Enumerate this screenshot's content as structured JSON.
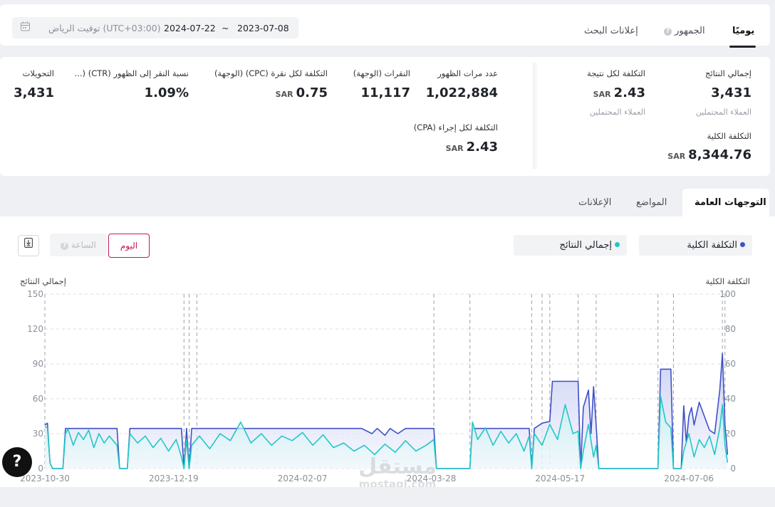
{
  "topbar": {
    "tabs": [
      {
        "label": "يوميًا",
        "active": true
      },
      {
        "label": "الجمهور",
        "active": false
      },
      {
        "label": "إعلانات البحث",
        "active": false
      }
    ],
    "timezone": "(UTC+03:00) توقيت الرياض",
    "date_from": "2023-07-08",
    "date_to": "2024-07-22",
    "date_separator": "~",
    "calendar_icon": "calendar-icon"
  },
  "metrics": {
    "total_results": {
      "label": "إجمالي النتائج",
      "value": "3,431",
      "sub": "العملاء المحتملين"
    },
    "cost_per_result": {
      "label": "التكلفة لكل نتيجة",
      "value": "2.43",
      "currency": "SAR",
      "sub": "العملاء المحتملين"
    },
    "total_cost": {
      "label": "التكلفة الكلية",
      "value": "8,344.76",
      "currency": "SAR"
    },
    "impressions": {
      "label": "عدد مرات الظهور",
      "value": "1,022,884"
    },
    "clicks": {
      "label": "النقرات (الوجهة)",
      "value": "11,117"
    },
    "cpc": {
      "label": "التكلفة لكل نقرة (CPC) (الوجهة)",
      "value": "0.75",
      "currency": "SAR"
    },
    "ctr": {
      "label": "نسبة النقر إلى الظهور (CTR) (...",
      "value": "1.09%"
    },
    "conversions": {
      "label": "التحويلات",
      "value": "3,431"
    },
    "cpa": {
      "label": "التكلفة لكل إجراء (CPA)",
      "value": "2.43",
      "currency": "SAR"
    }
  },
  "section_tabs": [
    {
      "label": "التوجهات العامة",
      "active": true
    },
    {
      "label": "المواضع",
      "active": false
    },
    {
      "label": "الإعلانات",
      "active": false
    }
  ],
  "chart_controls": {
    "day_button": "اليوم",
    "hour_button": "الساعة",
    "export_icon": "download-icon",
    "legend_cost": "التكلفة الكلية",
    "legend_results": "إجمالي النتائج"
  },
  "help_icon": "help-icon",
  "watermark": {
    "ar": "مستقل",
    "en": "mostaql.com"
  },
  "chart_data": {
    "type": "line",
    "left_axis_label": "إجمالي النتائج",
    "right_axis_label": "التكلفة الكلية",
    "left_ticks": [
      0,
      30,
      60,
      90,
      120,
      150
    ],
    "right_ticks": [
      0,
      20,
      40,
      60,
      80,
      100
    ],
    "ylim_left": [
      0,
      150
    ],
    "ylim_right": [
      0,
      100
    ],
    "x_tick_labels": [
      "2023-10-30",
      "2023-12-19",
      "2024-02-07",
      "2024-03-28",
      "2024-05-17",
      "2024-07-06"
    ],
    "x_range": [
      "2023-10-30",
      "2024-07-22"
    ],
    "grid": true,
    "colors": {
      "cost": "#3f51c6",
      "results": "#22c7c7",
      "cost_fill": "#d9ddf6",
      "results_fill": "#d7f6f6"
    },
    "series": [
      {
        "name": "التكلفة الكلية",
        "axis": "right",
        "color": "#3f51c6",
        "values": [
          [
            "2023-10-30",
            25
          ],
          [
            "2023-10-31",
            26
          ],
          [
            "2023-11-01",
            3
          ],
          [
            "2023-11-02",
            0
          ],
          [
            "2023-11-06",
            0
          ],
          [
            "2023-11-07",
            23
          ],
          [
            "2023-11-10",
            23
          ],
          [
            "2023-11-20",
            23
          ],
          [
            "2023-11-27",
            23
          ],
          [
            "2023-11-28",
            0
          ],
          [
            "2023-12-01",
            0
          ],
          [
            "2023-12-02",
            23
          ],
          [
            "2023-12-10",
            23
          ],
          [
            "2023-12-22",
            23
          ],
          [
            "2023-12-23",
            0
          ],
          [
            "2023-12-24",
            23
          ],
          [
            "2023-12-25",
            0
          ],
          [
            "2023-12-26",
            23
          ],
          [
            "2024-01-10",
            23
          ],
          [
            "2024-02-01",
            23
          ],
          [
            "2024-02-20",
            23
          ],
          [
            "2024-03-01",
            23
          ],
          [
            "2024-03-05",
            20
          ],
          [
            "2024-03-07",
            23
          ],
          [
            "2024-03-10",
            19
          ],
          [
            "2024-03-12",
            23
          ],
          [
            "2024-03-15",
            20
          ],
          [
            "2024-03-18",
            23
          ],
          [
            "2024-03-29",
            23
          ],
          [
            "2024-03-30",
            0
          ],
          [
            "2024-04-12",
            0
          ],
          [
            "2024-04-13",
            23
          ],
          [
            "2024-04-25",
            23
          ],
          [
            "2024-05-05",
            23
          ],
          [
            "2024-05-06",
            0
          ],
          [
            "2024-05-07",
            23
          ],
          [
            "2024-05-10",
            26
          ],
          [
            "2024-05-13",
            27
          ],
          [
            "2024-05-14",
            50
          ],
          [
            "2024-05-24",
            50
          ],
          [
            "2024-05-25",
            0
          ],
          [
            "2024-05-26",
            35
          ],
          [
            "2024-05-27",
            40
          ],
          [
            "2024-05-28",
            45
          ],
          [
            "2024-05-29",
            20
          ],
          [
            "2024-05-30",
            47
          ],
          [
            "2024-05-31",
            25
          ],
          [
            "2024-06-01",
            0
          ],
          [
            "2024-06-24",
            0
          ],
          [
            "2024-06-25",
            57
          ],
          [
            "2024-06-29",
            57
          ],
          [
            "2024-06-30",
            0
          ],
          [
            "2024-07-03",
            0
          ],
          [
            "2024-07-04",
            36
          ],
          [
            "2024-07-05",
            15
          ],
          [
            "2024-07-06",
            30
          ],
          [
            "2024-07-07",
            35
          ],
          [
            "2024-07-08",
            25
          ],
          [
            "2024-07-10",
            38
          ],
          [
            "2024-07-12",
            30
          ],
          [
            "2024-07-14",
            22
          ],
          [
            "2024-07-16",
            20
          ],
          [
            "2024-07-18",
            45
          ],
          [
            "2024-07-19",
            66
          ],
          [
            "2024-07-20",
            25
          ],
          [
            "2024-07-21",
            8
          ]
        ]
      },
      {
        "name": "إجمالي النتائج",
        "axis": "left",
        "color": "#22c7c7",
        "values": [
          [
            "2023-10-30",
            36
          ],
          [
            "2023-10-31",
            35
          ],
          [
            "2023-11-01",
            5
          ],
          [
            "2023-11-02",
            0
          ],
          [
            "2023-11-06",
            0
          ],
          [
            "2023-11-07",
            30
          ],
          [
            "2023-11-08",
            34
          ],
          [
            "2023-11-10",
            20
          ],
          [
            "2023-11-12",
            31
          ],
          [
            "2023-11-14",
            25
          ],
          [
            "2023-11-16",
            33
          ],
          [
            "2023-11-18",
            18
          ],
          [
            "2023-11-20",
            30
          ],
          [
            "2023-11-22",
            22
          ],
          [
            "2023-11-24",
            28
          ],
          [
            "2023-11-27",
            20
          ],
          [
            "2023-11-28",
            0
          ],
          [
            "2023-12-01",
            0
          ],
          [
            "2023-12-02",
            30
          ],
          [
            "2023-12-05",
            22
          ],
          [
            "2023-12-08",
            28
          ],
          [
            "2023-12-11",
            18
          ],
          [
            "2023-12-14",
            26
          ],
          [
            "2023-12-17",
            15
          ],
          [
            "2023-12-20",
            25
          ],
          [
            "2023-12-22",
            10
          ],
          [
            "2023-12-23",
            0
          ],
          [
            "2023-12-24",
            25
          ],
          [
            "2023-12-25",
            0
          ],
          [
            "2023-12-26",
            20
          ],
          [
            "2023-12-29",
            28
          ],
          [
            "2024-01-02",
            17
          ],
          [
            "2024-01-06",
            30
          ],
          [
            "2024-01-10",
            24
          ],
          [
            "2024-01-14",
            40
          ],
          [
            "2024-01-18",
            22
          ],
          [
            "2024-01-22",
            30
          ],
          [
            "2024-01-26",
            20
          ],
          [
            "2024-01-30",
            28
          ],
          [
            "2024-02-03",
            24
          ],
          [
            "2024-02-07",
            31
          ],
          [
            "2024-02-11",
            20
          ],
          [
            "2024-02-15",
            29
          ],
          [
            "2024-02-19",
            18
          ],
          [
            "2024-02-23",
            22
          ],
          [
            "2024-02-27",
            15
          ],
          [
            "2024-03-02",
            20
          ],
          [
            "2024-03-06",
            12
          ],
          [
            "2024-03-10",
            21
          ],
          [
            "2024-03-14",
            14
          ],
          [
            "2024-03-18",
            24
          ],
          [
            "2024-03-22",
            15
          ],
          [
            "2024-03-26",
            20
          ],
          [
            "2024-03-29",
            25
          ],
          [
            "2024-03-30",
            0
          ],
          [
            "2024-04-12",
            0
          ],
          [
            "2024-04-13",
            40
          ],
          [
            "2024-04-15",
            25
          ],
          [
            "2024-04-18",
            35
          ],
          [
            "2024-04-21",
            20
          ],
          [
            "2024-04-24",
            32
          ],
          [
            "2024-04-27",
            22
          ],
          [
            "2024-04-30",
            30
          ],
          [
            "2024-05-03",
            15
          ],
          [
            "2024-05-05",
            28
          ],
          [
            "2024-05-06",
            0
          ],
          [
            "2024-05-07",
            30
          ],
          [
            "2024-05-10",
            20
          ],
          [
            "2024-05-13",
            38
          ],
          [
            "2024-05-16",
            25
          ],
          [
            "2024-05-19",
            55
          ],
          [
            "2024-05-22",
            30
          ],
          [
            "2024-05-24",
            32
          ],
          [
            "2024-05-25",
            0
          ],
          [
            "2024-05-26",
            15
          ],
          [
            "2024-05-28",
            38
          ],
          [
            "2024-05-30",
            10
          ],
          [
            "2024-05-31",
            20
          ],
          [
            "2024-06-01",
            0
          ],
          [
            "2024-06-24",
            0
          ],
          [
            "2024-06-25",
            62
          ],
          [
            "2024-06-27",
            40
          ],
          [
            "2024-06-29",
            35
          ],
          [
            "2024-06-30",
            0
          ],
          [
            "2024-07-03",
            0
          ],
          [
            "2024-07-04",
            15
          ],
          [
            "2024-07-06",
            30
          ],
          [
            "2024-07-08",
            10
          ],
          [
            "2024-07-10",
            25
          ],
          [
            "2024-07-12",
            18
          ],
          [
            "2024-07-14",
            28
          ],
          [
            "2024-07-16",
            12
          ],
          [
            "2024-07-18",
            35
          ],
          [
            "2024-07-19",
            55
          ],
          [
            "2024-07-20",
            20
          ],
          [
            "2024-07-21",
            5
          ]
        ]
      }
    ],
    "vertical_markers": [
      "2023-10-30",
      "2023-12-23",
      "2023-12-25",
      "2023-12-28",
      "2024-03-29",
      "2024-04-12",
      "2024-05-06",
      "2024-05-10",
      "2024-05-13",
      "2024-05-24",
      "2024-05-31",
      "2024-06-24",
      "2024-06-30",
      "2024-07-19",
      "2024-07-20"
    ]
  }
}
